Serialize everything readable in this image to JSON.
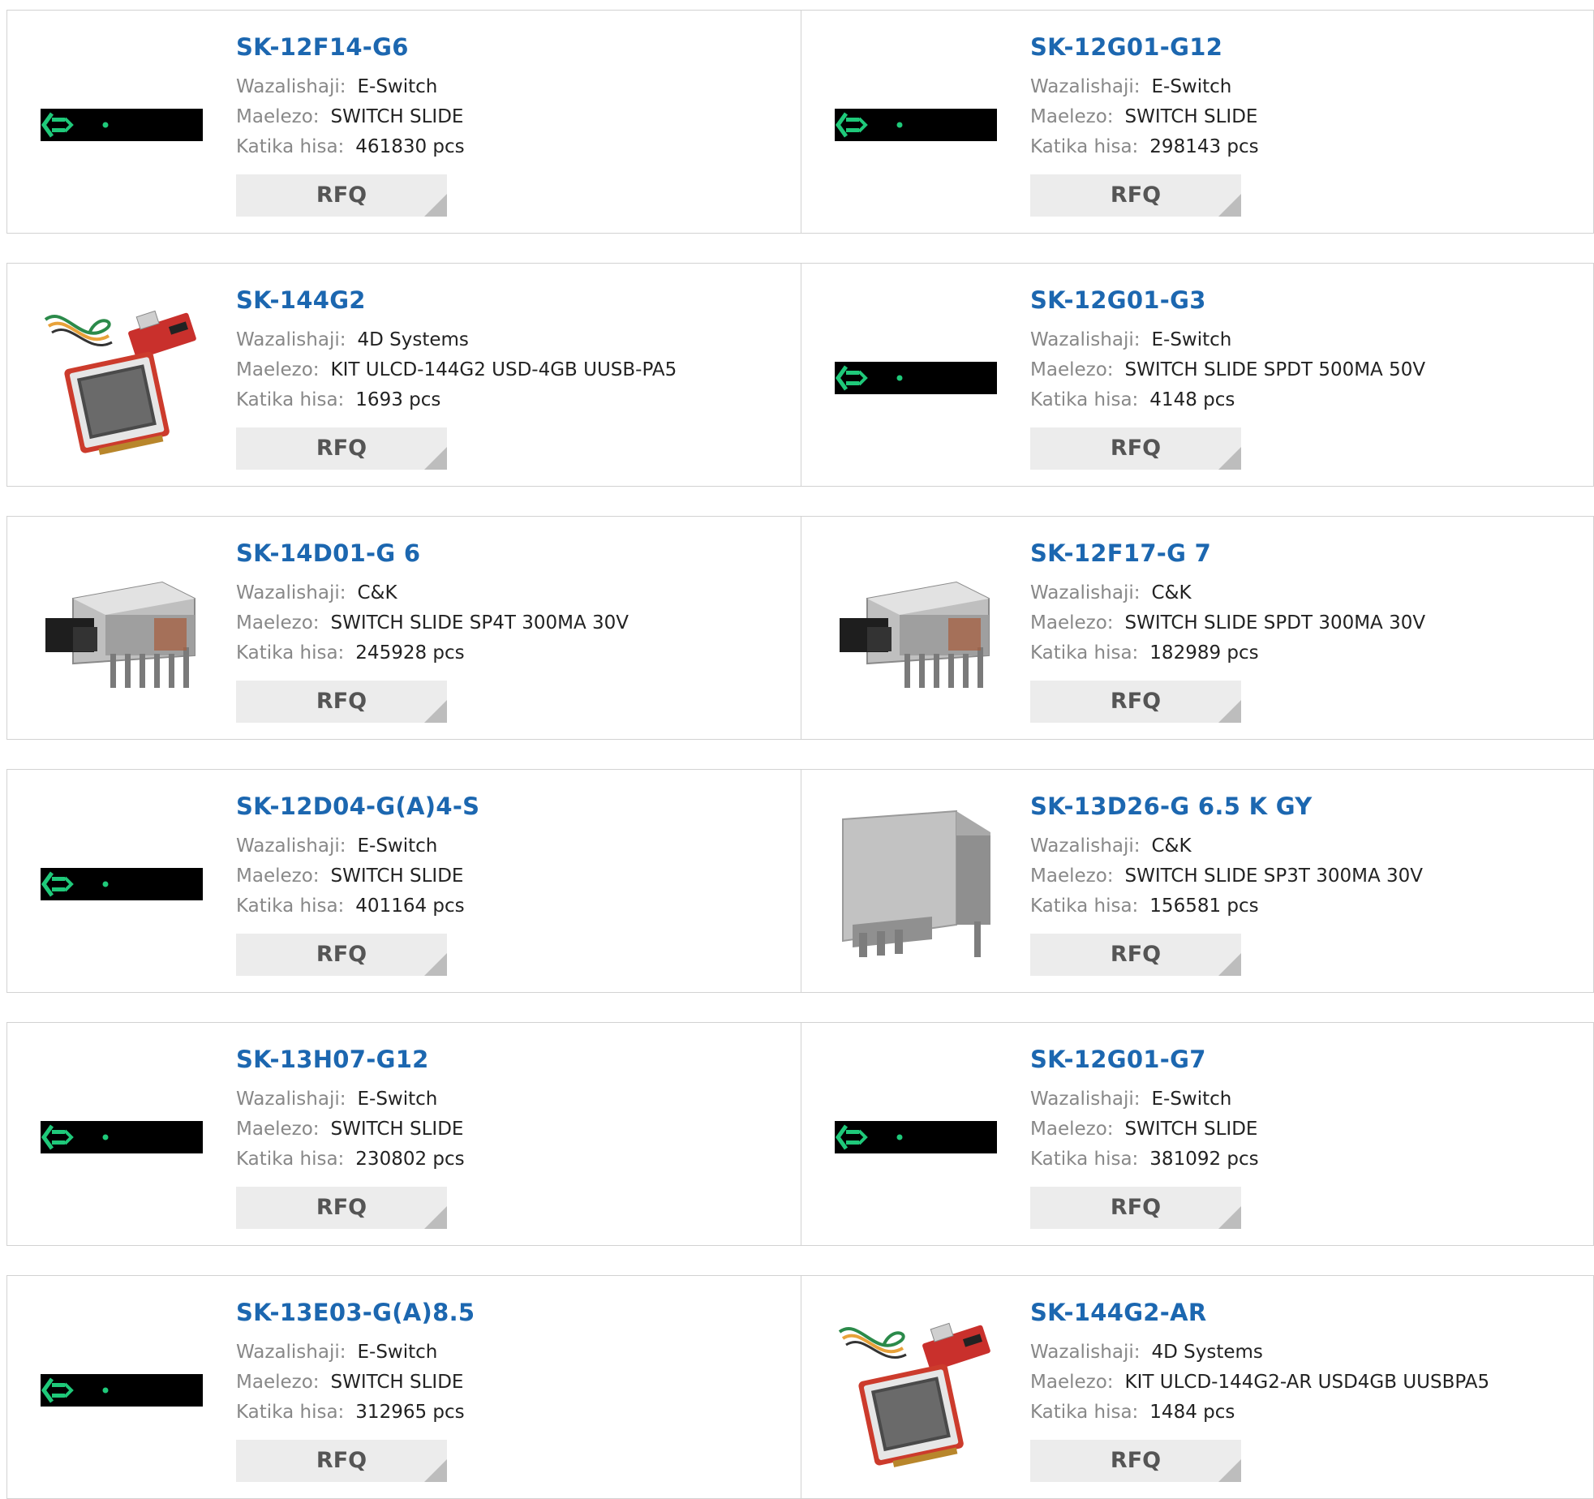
{
  "labels": {
    "manufacturer": "Wazalishaji:",
    "description": "Maelezo:",
    "stock": "Katika hisa:",
    "rfq": "RFQ"
  },
  "products": [
    {
      "part": "SK-12F14-G6",
      "manufacturer": "E-Switch",
      "description": "SWITCH SLIDE",
      "stock": "461830 pcs",
      "image": "placeholder-strip-icon"
    },
    {
      "part": "SK-12G01-G12",
      "manufacturer": "E-Switch",
      "description": "SWITCH SLIDE",
      "stock": "298143 pcs",
      "image": "placeholder-strip-icon"
    },
    {
      "part": "SK-144G2",
      "manufacturer": "4D Systems",
      "description": "KIT ULCD-144G2 USD-4GB UUSB-PA5",
      "stock": "1693 pcs",
      "image": "lcd-kit-icon"
    },
    {
      "part": "SK-12G01-G3",
      "manufacturer": "E-Switch",
      "description": "SWITCH SLIDE SPDT 500MA 50V",
      "stock": "4148 pcs",
      "image": "placeholder-strip-icon"
    },
    {
      "part": "SK-14D01-G 6",
      "manufacturer": "C&K",
      "description": "SWITCH SLIDE SP4T 300MA 30V",
      "stock": "245928 pcs",
      "image": "slide-switch-icon"
    },
    {
      "part": "SK-12F17-G 7",
      "manufacturer": "C&K",
      "description": "SWITCH SLIDE SPDT 300MA 30V",
      "stock": "182989 pcs",
      "image": "slide-switch-icon"
    },
    {
      "part": "SK-12D04-G(A)4-S",
      "manufacturer": "E-Switch",
      "description": "SWITCH SLIDE",
      "stock": "401164 pcs",
      "image": "placeholder-strip-icon"
    },
    {
      "part": "SK-13D26-G 6.5 K GY",
      "manufacturer": "C&K",
      "description": "SWITCH SLIDE SP3T 300MA 30V",
      "stock": "156581 pcs",
      "image": "gray-slide-switch-icon"
    },
    {
      "part": "SK-13H07-G12",
      "manufacturer": "E-Switch",
      "description": "SWITCH SLIDE",
      "stock": "230802 pcs",
      "image": "placeholder-strip-icon"
    },
    {
      "part": "SK-12G01-G7",
      "manufacturer": "E-Switch",
      "description": "SWITCH SLIDE",
      "stock": "381092 pcs",
      "image": "placeholder-strip-icon"
    },
    {
      "part": "SK-13E03-G(A)8.5",
      "manufacturer": "E-Switch",
      "description": "SWITCH SLIDE",
      "stock": "312965 pcs",
      "image": "placeholder-strip-icon"
    },
    {
      "part": "SK-144G2-AR",
      "manufacturer": "4D Systems",
      "description": "KIT ULCD-144G2-AR USD4GB UUSBPA5",
      "stock": "1484 pcs",
      "image": "lcd-kit-icon"
    }
  ]
}
